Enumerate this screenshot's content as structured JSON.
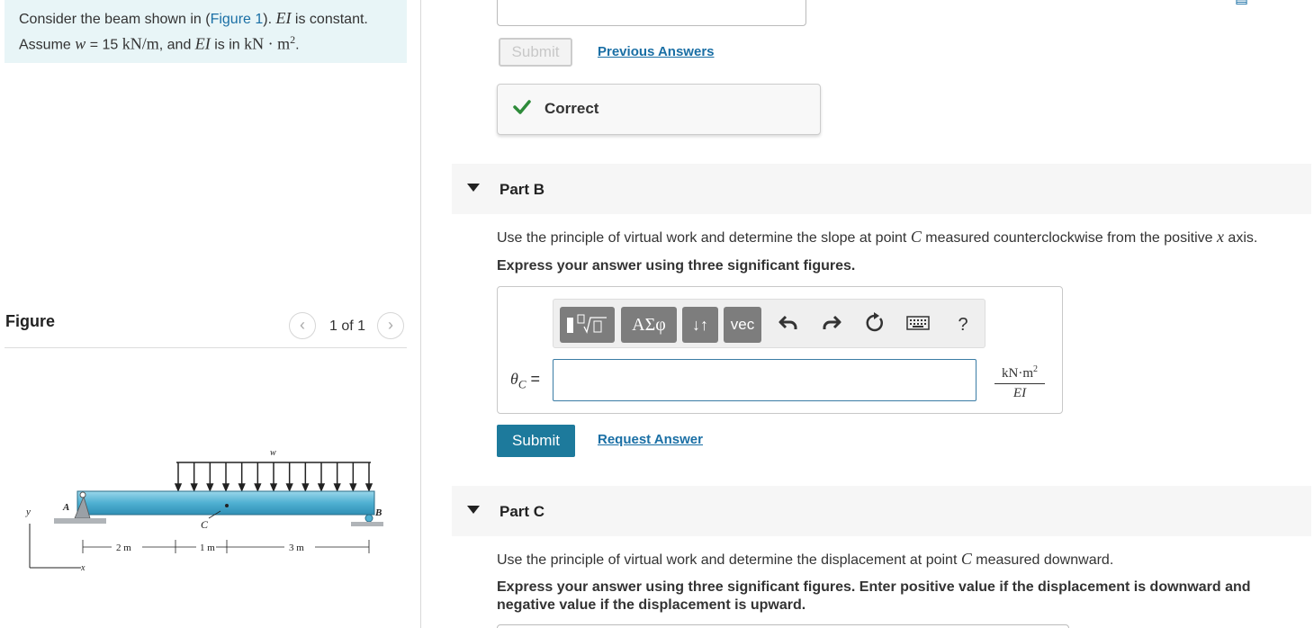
{
  "problem": {
    "t1": "Consider the beam shown in (",
    "figure_link": "Figure 1",
    "t2": "). ",
    "ei": "EI",
    "t3": " is constant.",
    "t4": "Assume ",
    "w": "w",
    "t5": " = 15 ",
    "w_unit": "kN/m",
    "t6": ", and ",
    "ei2": "EI",
    "t7": " is in ",
    "ei_unit": "kN · m",
    "sup": "2",
    "t8": "."
  },
  "figure": {
    "title": "Figure",
    "pager": "1 of 1",
    "labels": {
      "w": "w",
      "A": "A",
      "B": "B",
      "C": "C",
      "y": "y",
      "x": "x",
      "d1": "2 m",
      "d2": "1 m",
      "d3": "3 m"
    }
  },
  "part_a": {
    "submit_label": "Submit",
    "previous_answers": "Previous Answers",
    "correct_label": "Correct"
  },
  "part_b": {
    "header": "Part B",
    "q_pre": "Use the principle of virtual work and determine the slope at point ",
    "q_c": "C",
    "q_post": " measured counterclockwise from the positive ",
    "q_x": "x",
    "q_end": " axis.",
    "instructions": "Express your answer using three significant figures.",
    "toolbar": {
      "greek": "ΑΣφ",
      "arrows": "↓↑",
      "vec": "vec",
      "help": "?"
    },
    "answer_label_theta": "θ",
    "answer_label_sub": "C",
    "answer_label_eq": " =",
    "unit_num": "kN·m",
    "unit_sup": "2",
    "unit_den": "EI",
    "submit_label": "Submit",
    "request_answer": "Request Answer"
  },
  "part_c": {
    "header": "Part C",
    "q_pre": "Use the principle of virtual work and determine the displacement at point ",
    "q_c": "C",
    "q_post": " measured downward.",
    "instructions_1": "Express your answer using three significant figures. Enter positive value if the displacement is downward and",
    "instructions_2": "negative value if the displacement is upward."
  },
  "colors": {
    "accent": "#1d7a9c",
    "link": "#1a6fa5",
    "correct_check": "#2e8b3a",
    "problem_bg": "#e8f5f7",
    "beam": "#5bb8d6"
  },
  "icons": [
    "templates-icon",
    "undo-icon",
    "redo-icon",
    "reset-icon",
    "keyboard-icon",
    "check-icon",
    "chevron-left-icon",
    "chevron-right-icon",
    "triangle-down-icon"
  ]
}
